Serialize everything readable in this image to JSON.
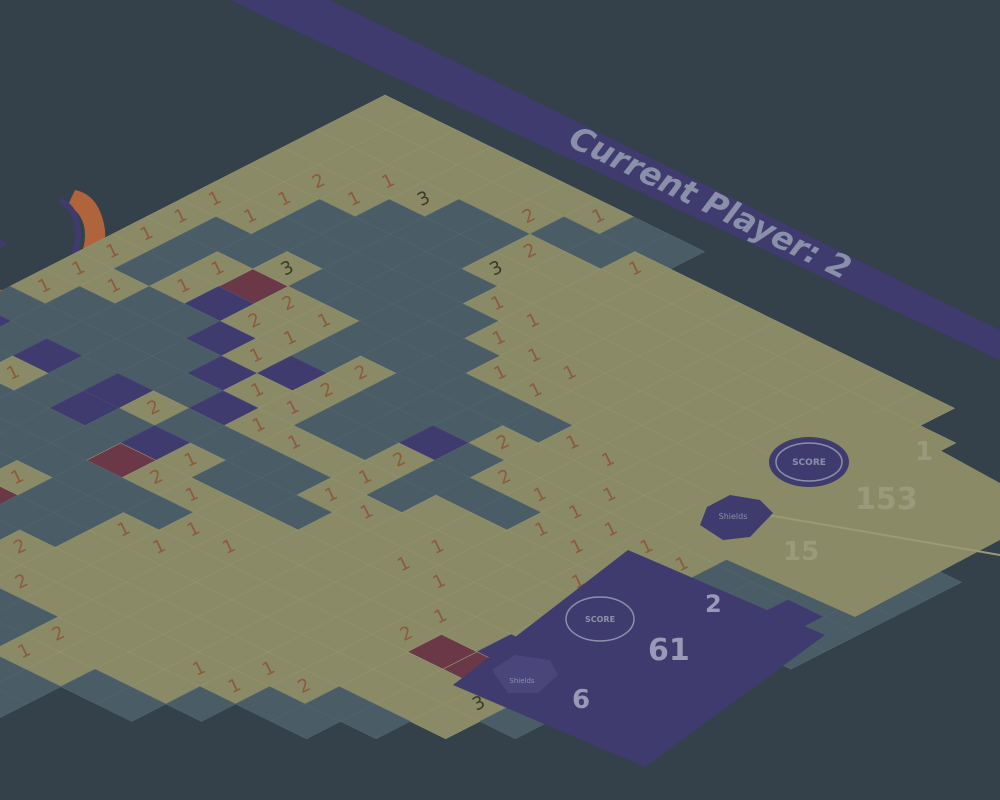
{
  "banner": {
    "current_player": "Current Player: 2"
  },
  "colors": {
    "background": "#34404a",
    "banner": "#3f3b6e",
    "revealed": "#8a8a66",
    "hidden": "#4a5c66",
    "player1_flag": "#3f3b6e",
    "mine": "#6a3846",
    "number": "#8c5a3c",
    "timer_ring": "#b0643c",
    "player1_panel": "#8a8a66",
    "player2_panel": "#3f3b6e"
  },
  "board": {
    "rows": [
      "RRRRRR1HH.............",
      "RRRRR2HH1RRRRRRRR.....",
      "RR13HH2RRRRRRRRRRR....",
      "R21HHH3RRRRRRRRRRRR...",
      "R1HHHHH11RRRRRRRRRRR..",
      "11HHHHHH111RRRRRRRRRR.",
      "1HH3HHHHH11RRRRRRRRR1H",
      "1H1B21HHHHHH11RRR2MHHH",
      "1H1P21H2HHH2RR1RR2HHHH",
      "11HHP1P2HHPH211111HHPH",
      "1HHHHP11HH2HHH11RR1HHH",
      "HHHHHHP11R1HRRRR1HHH..",
      "PHPHP2HHHH11R1RRR1P...",
      "HH1HPHP1HHHRR11RRR2...",
      "HHHHHHB21RRRRRR1RP....",
      "HHHHHHHHH11RRRR2MMPP..",
      "PHPHH1HH11RRRRRRRR3H..",
      "HHH1HBHHRRRRRRRRRRR...",
      "HHHHPHH2RRRRRR12HH....",
      "HHHHHHP22RRRR11HH.....",
      "HHHHHHHHHH2RRRH.......",
      "HHPHHHHHHH1RHH........",
      "HHHHHH33RRHH..........",
      "HHHHHHHHH2RH..........",
      "HHHHHHHHHH1H..........",
      "HHHHHHHHH1HH..........",
      "HHHHHHHHHHHH.........."
    ]
  },
  "player1": {
    "number": "1",
    "score": "153",
    "flags": "15",
    "score_badge": "SCORE",
    "flag_badge": "Shields"
  },
  "player2": {
    "number": "2",
    "score": "61",
    "flags": "6",
    "score_badge": "SCORE",
    "flag_badge": "Shields"
  }
}
